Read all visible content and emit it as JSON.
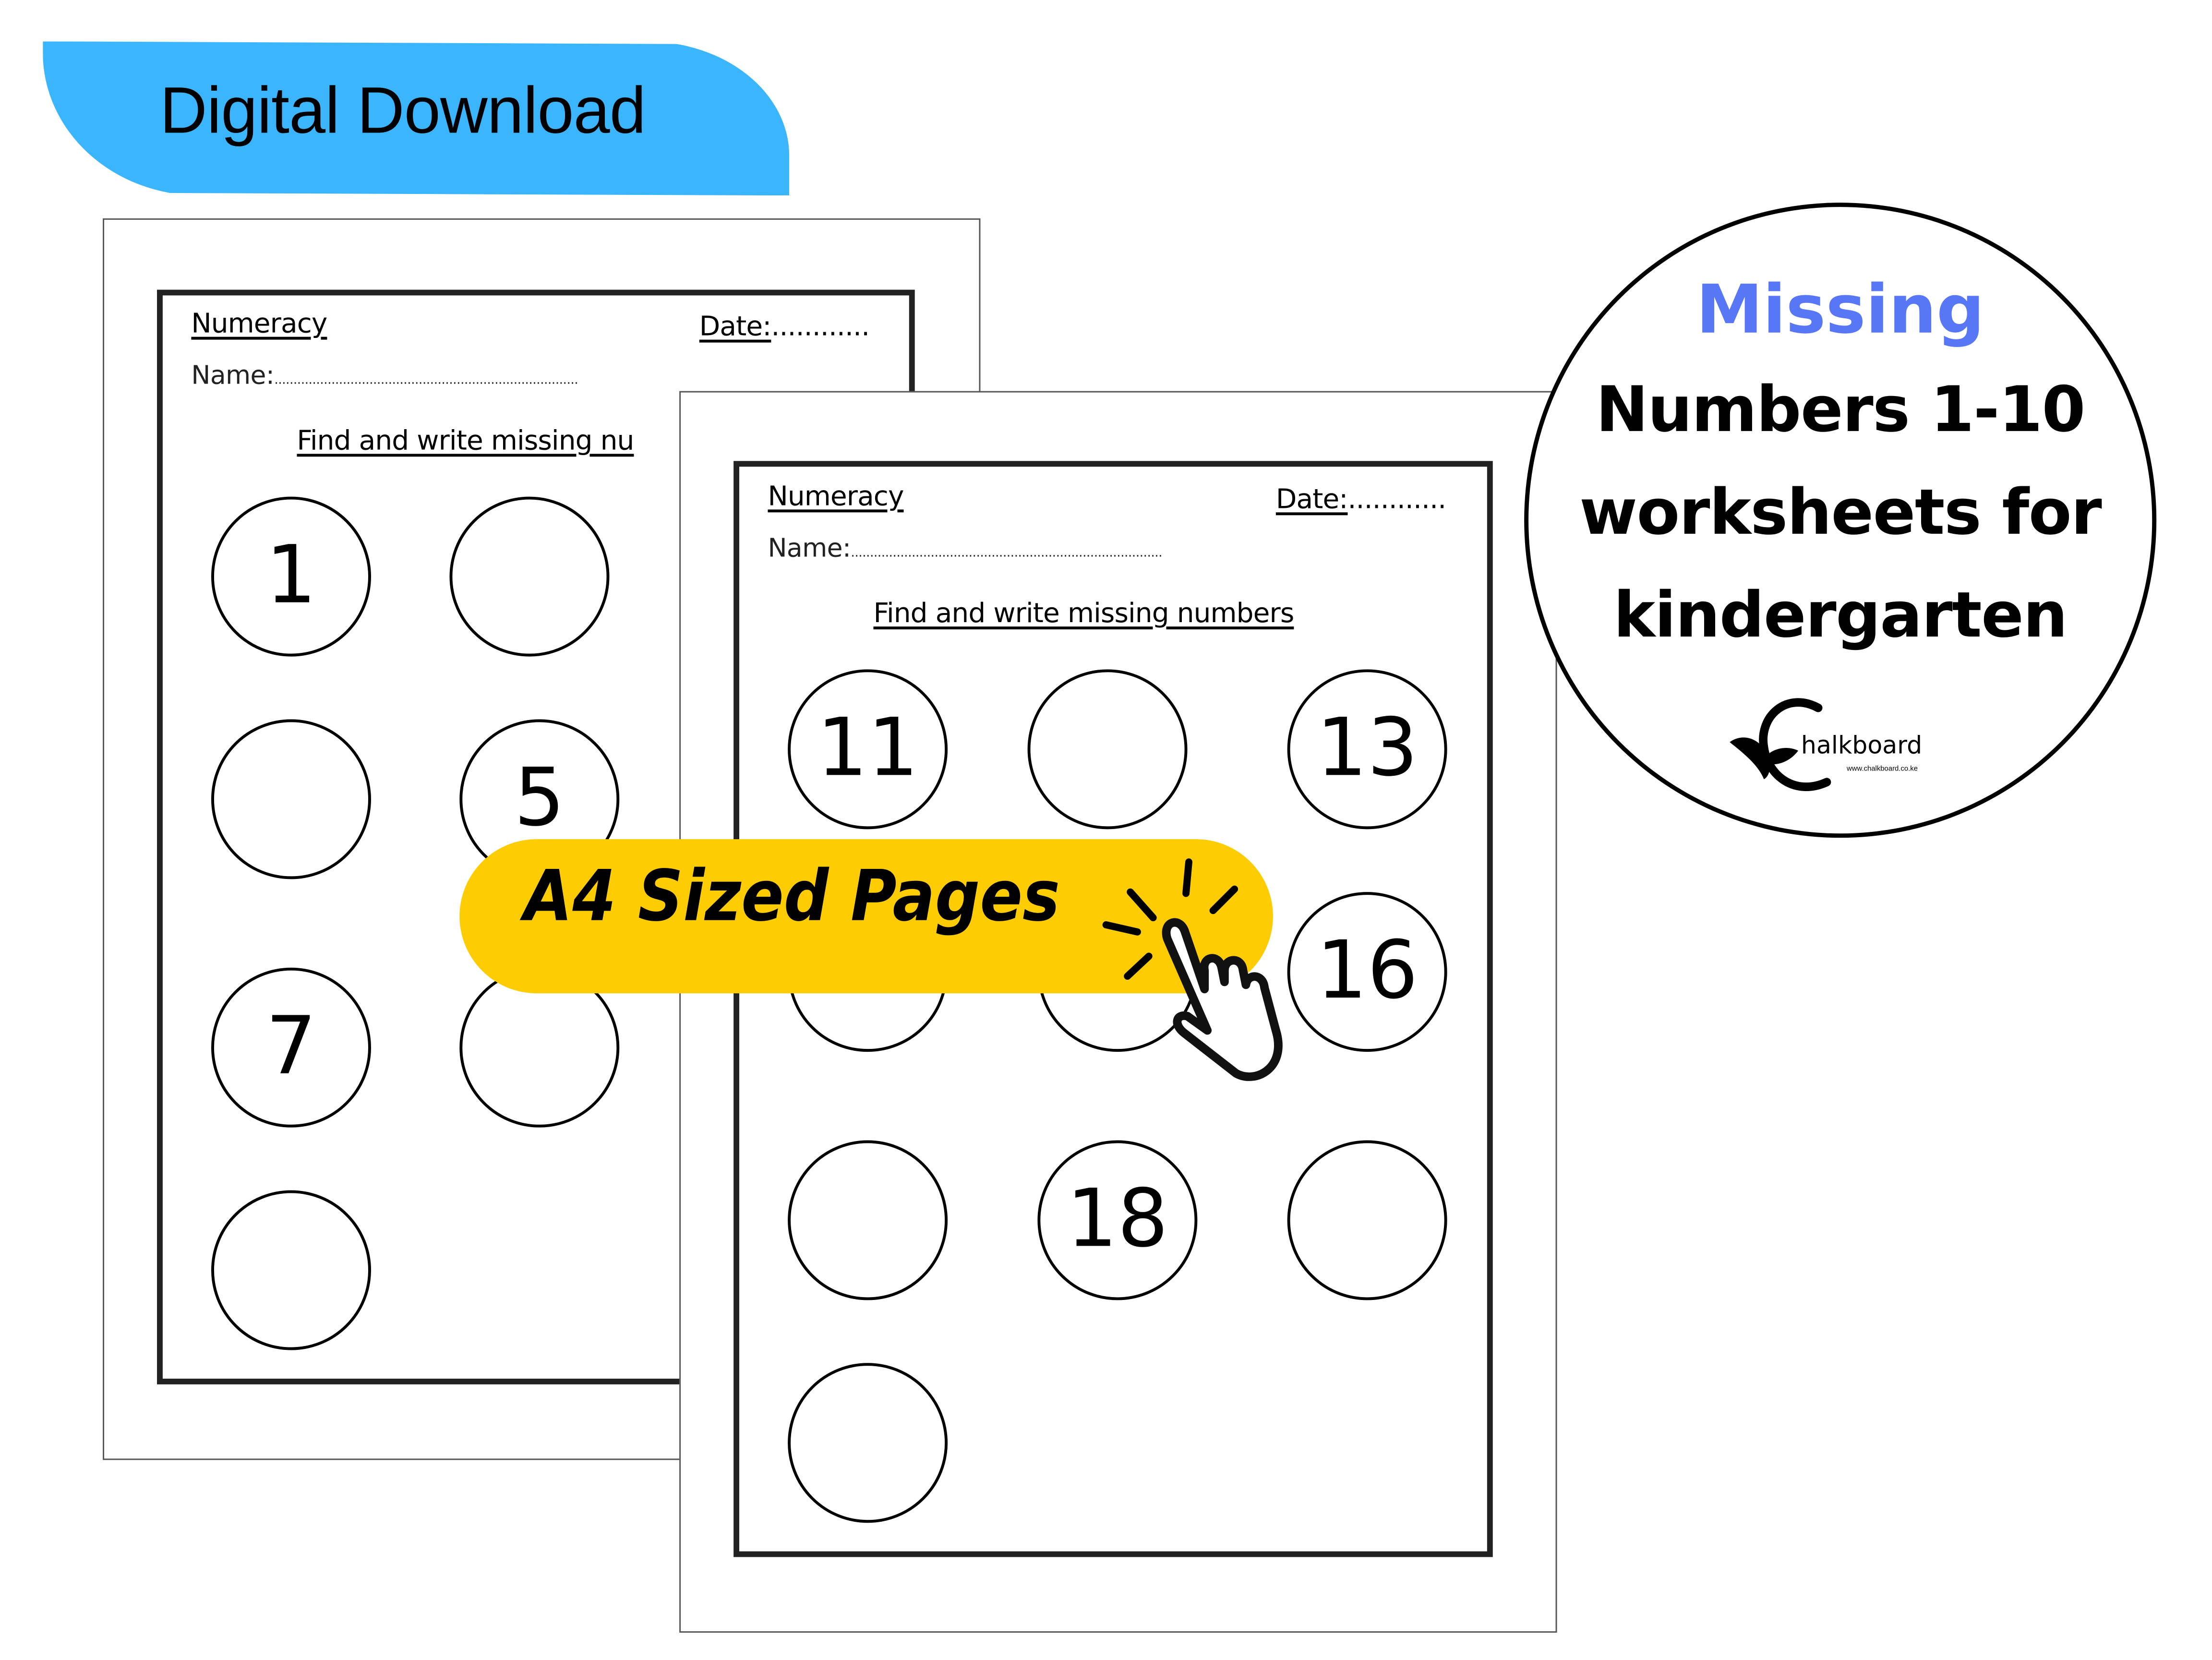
{
  "banner": {
    "label": "Digital Download",
    "color": "#3bb5fd"
  },
  "worksheet_back": {
    "subject": "Numeracy",
    "date_label": "Date:",
    "date_dots": "............",
    "name_label": "Name:",
    "name_dots": "................................................................................",
    "instruction": "Find and write missing nu",
    "circles": [
      {
        "value": "1"
      },
      {
        "value": ""
      },
      {
        "value": ""
      },
      {
        "value": "5"
      },
      {
        "value": "7"
      },
      {
        "value": ""
      },
      {
        "value": ""
      }
    ]
  },
  "worksheet_front": {
    "subject": "Numeracy",
    "date_label": "Date:",
    "date_dots": "............",
    "name_label": "Name:",
    "name_dots": "..................................................................................",
    "instruction": "Find and write missing numbers ",
    "circles": [
      {
        "value": "11"
      },
      {
        "value": ""
      },
      {
        "value": "13"
      },
      {
        "value": ""
      },
      {
        "value": ""
      },
      {
        "value": "16"
      },
      {
        "value": ""
      },
      {
        "value": "18"
      },
      {
        "value": ""
      },
      {
        "value": ""
      }
    ]
  },
  "callout": {
    "label": "A4 Sized Pages",
    "icon": "pointing-hand-click-icon",
    "color": "#fecc02"
  },
  "badge": {
    "title": "Missing",
    "title_color": "#5777f6",
    "line1": "Numbers 1-10",
    "line2": "worksheets for",
    "line3": "kindergarten"
  },
  "logo": {
    "name": "halkboard",
    "initial": "C",
    "url": "www.chalkboard.co.ke",
    "icon": "leaf-icon"
  }
}
